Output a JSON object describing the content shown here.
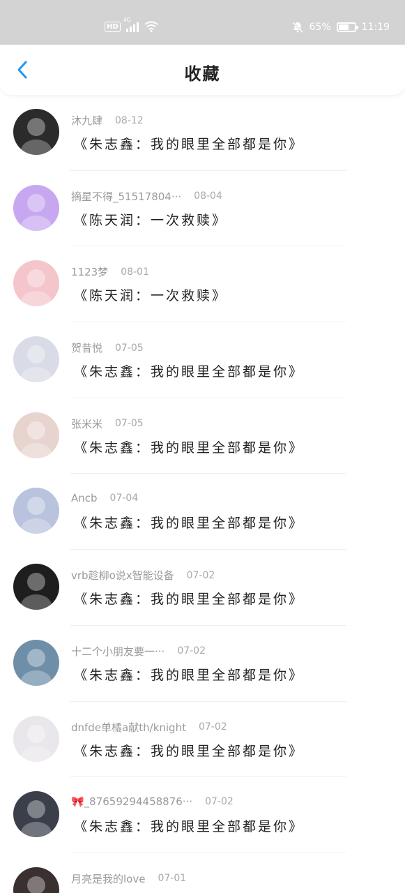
{
  "status_bar": {
    "network": "4G",
    "hd": "HD",
    "battery_percent": "65%",
    "battery_level": 0.65,
    "time": "11:19",
    "icons": [
      "signal-icon",
      "wifi-icon",
      "mute-icon",
      "battery-icon"
    ]
  },
  "header": {
    "title": "收藏",
    "back_icon": "chevron-left-icon",
    "accent": "#2196f3"
  },
  "items": [
    {
      "user": "沐九肆",
      "time": "08-12",
      "content": "《朱志鑫：我的眼里全部都是你》",
      "avatar_color": "#2b2b2b"
    },
    {
      "user": "摘星不得_51517804···",
      "time": "08-04",
      "content": "《陈天润：一次救赎》",
      "avatar_color": "#c7a8f0"
    },
    {
      "user": "1123梦",
      "time": "08-01",
      "content": "《陈天润：一次救赎》",
      "avatar_color": "#f4c6cc"
    },
    {
      "user": "贺昔悦",
      "time": "07-05",
      "content": "《朱志鑫：我的眼里全部都是你》",
      "avatar_color": "#d9dce6"
    },
    {
      "user": "张米米",
      "time": "07-05",
      "content": "《朱志鑫：我的眼里全部都是你》",
      "avatar_color": "#e8d4cf"
    },
    {
      "user": "Ancb",
      "time": "07-04",
      "content": "《朱志鑫：我的眼里全部都是你》",
      "avatar_color": "#b9c3de"
    },
    {
      "user": "vrb趁柳o说x智能设备",
      "time": "07-02",
      "content": "《朱志鑫：我的眼里全部都是你》",
      "avatar_color": "#1e1e1e"
    },
    {
      "user": "十二个小朋友要一···",
      "time": "07-02",
      "content": "《朱志鑫：我的眼里全部都是你》",
      "avatar_color": "#6f8fa8"
    },
    {
      "user": "dnfde单橘a献th/knight",
      "time": "07-02",
      "content": "《朱志鑫：我的眼里全部都是你》",
      "avatar_color": "#eae7ec"
    },
    {
      "user": "🎀_87659294458876···",
      "time": "07-02",
      "content": "《朱志鑫：我的眼里全部都是你》",
      "avatar_color": "#3a3f4a"
    },
    {
      "user": "月亮是我的love",
      "time": "07-01",
      "content": "",
      "avatar_color": "#3b3030"
    }
  ]
}
